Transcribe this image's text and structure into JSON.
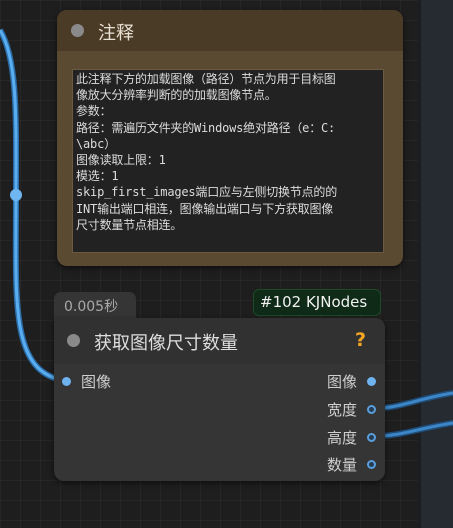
{
  "note_node": {
    "title": "注释",
    "lines": [
      "此注释下方的加载图像（路径）节点为用于目标图",
      "像放大分辨率判断的的加载图像节点。",
      "参数：",
      "路径：需遍历文件夹的Windows绝对路径（e：C:",
      "\\abc）",
      "图像读取上限：1",
      "模选：1",
      "skip_first_images端口应与左侧切换节点的的",
      "INT输出端口相连，图像输出端口与下方获取图像",
      "尺寸数量节点相连。"
    ]
  },
  "main_node": {
    "timing": "0.005秒",
    "badge": "#102 KJNodes",
    "title": "获取图像尺寸数量",
    "help": "?",
    "input_image": "图像",
    "output_image": "图像",
    "output_width": "宽度",
    "output_height": "高度",
    "output_count": "数量"
  },
  "colors": {
    "wire": "#4da3e8",
    "note_body": "#5a4a32",
    "badge_bg": "#0f2a17",
    "help": "#f5a623"
  }
}
